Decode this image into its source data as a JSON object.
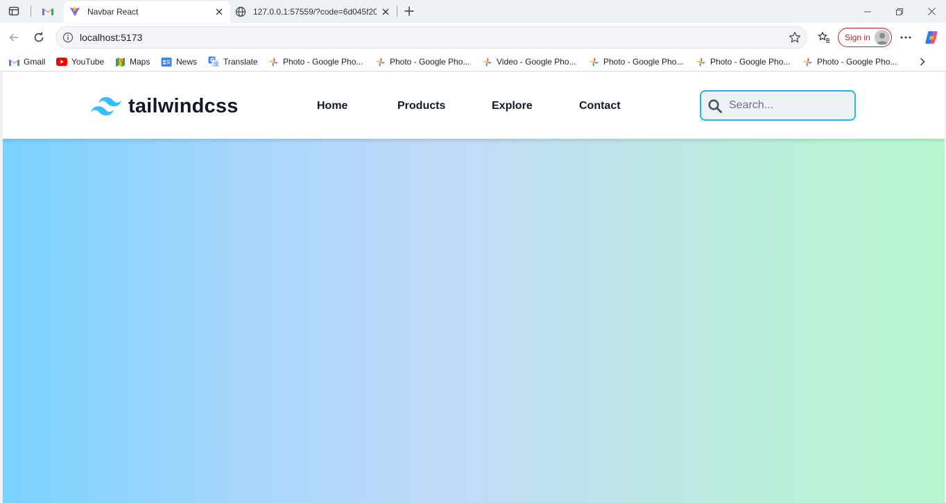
{
  "browser": {
    "tabs": [
      {
        "title": "Navbar React",
        "active": true
      },
      {
        "title": "127.0.0.1:57559/?code=6d045f20",
        "active": false
      }
    ],
    "address": "localhost:5173",
    "sign_in_label": "Sign in",
    "bookmarks": [
      {
        "label": "Gmail",
        "icon": "gmail-icon"
      },
      {
        "label": "YouTube",
        "icon": "youtube-icon"
      },
      {
        "label": "Maps",
        "icon": "maps-icon"
      },
      {
        "label": "News",
        "icon": "news-icon"
      },
      {
        "label": "Translate",
        "icon": "translate-icon"
      },
      {
        "label": "Photo - Google Pho...",
        "icon": "google-photos-icon"
      },
      {
        "label": "Photo - Google Pho...",
        "icon": "google-photos-icon"
      },
      {
        "label": "Video - Google Pho...",
        "icon": "google-photos-icon"
      },
      {
        "label": "Photo - Google Pho...",
        "icon": "google-photos-icon"
      },
      {
        "label": "Photo - Google Pho...",
        "icon": "google-photos-icon"
      },
      {
        "label": "Photo - Google Pho...",
        "icon": "google-photos-icon"
      }
    ]
  },
  "site": {
    "logo_text": "tailwindcss",
    "nav": [
      "Home",
      "Products",
      "Explore",
      "Contact"
    ],
    "search_placeholder": "Search...",
    "colors": {
      "logo_accent": "#38bdf8",
      "search_border": "#22b7e8",
      "gradient_start": "#79d2ff",
      "gradient_mid": "#c0daf9",
      "gradient_end": "#b6f7d0"
    }
  }
}
